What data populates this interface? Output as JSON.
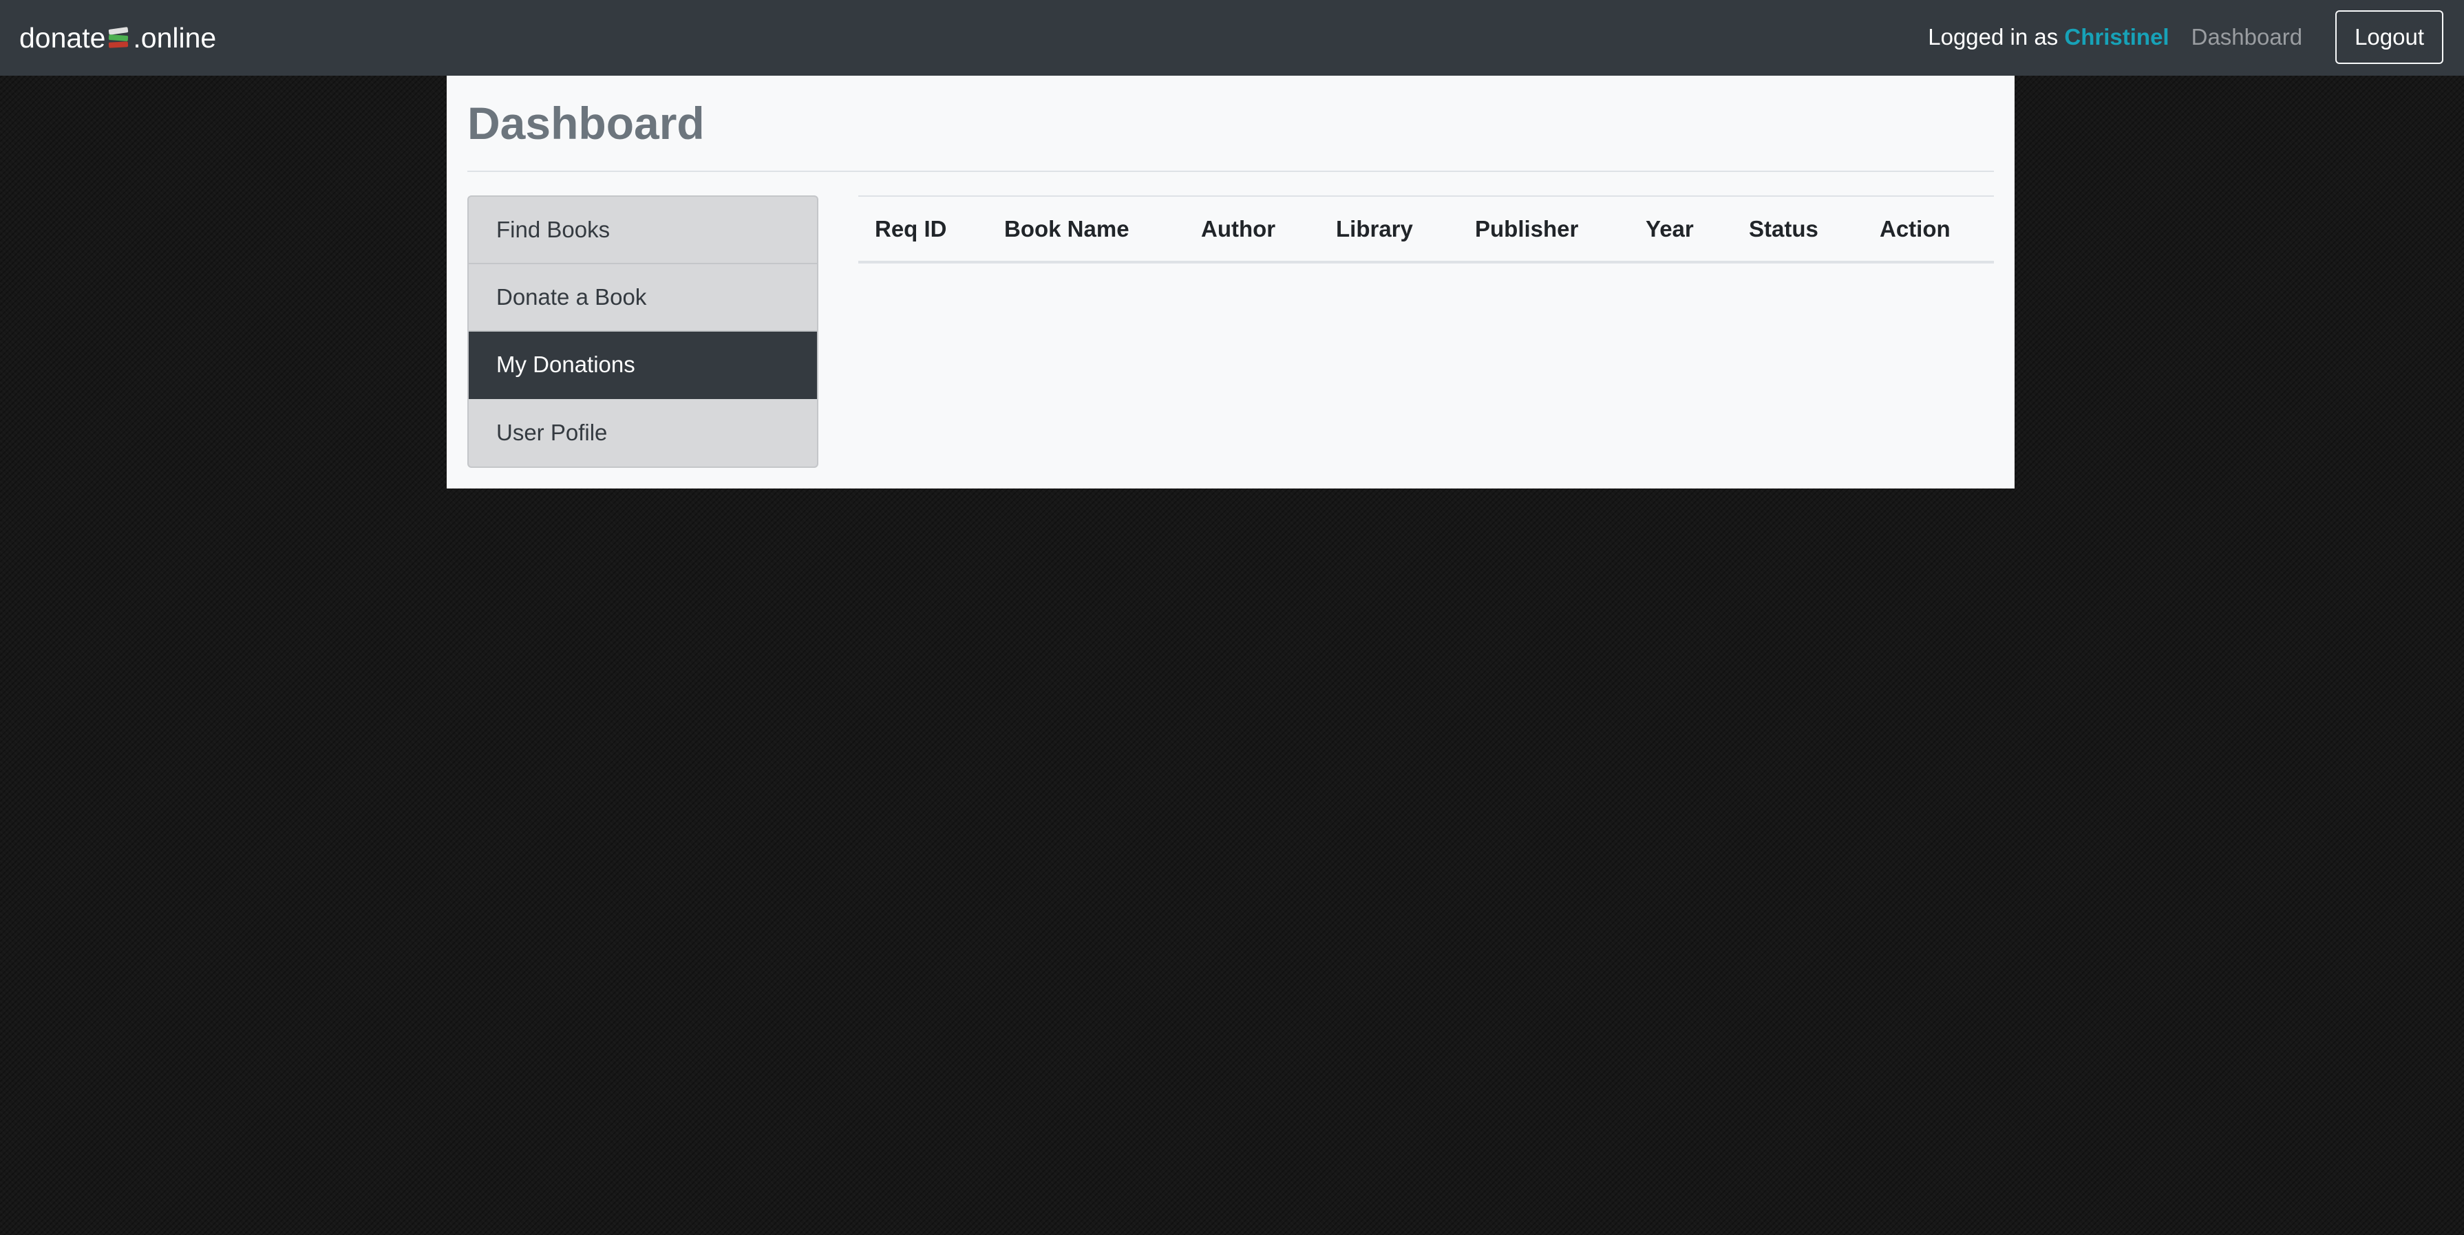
{
  "navbar": {
    "brand_prefix": "donate",
    "brand_suffix": ".online",
    "brand_icon": "books-icon",
    "logged_in_prefix": "Logged in as ",
    "username": "Christinel",
    "dashboard_link": "Dashboard",
    "logout_label": "Logout"
  },
  "main": {
    "title": "Dashboard"
  },
  "sidebar": {
    "items": [
      {
        "label": "Find Books",
        "active": false
      },
      {
        "label": "Donate a Book",
        "active": false
      },
      {
        "label": "My Donations",
        "active": true
      },
      {
        "label": "User Pofile",
        "active": false
      }
    ]
  },
  "table": {
    "columns": [
      "Req ID",
      "Book Name",
      "Author",
      "Library",
      "Publisher",
      "Year",
      "Status",
      "Action"
    ],
    "rows": []
  },
  "colors": {
    "navbar_bg": "#343a40",
    "username": "#17a2b8",
    "active_item_bg": "#343a40",
    "panel_bg": "#f8f9fa"
  }
}
